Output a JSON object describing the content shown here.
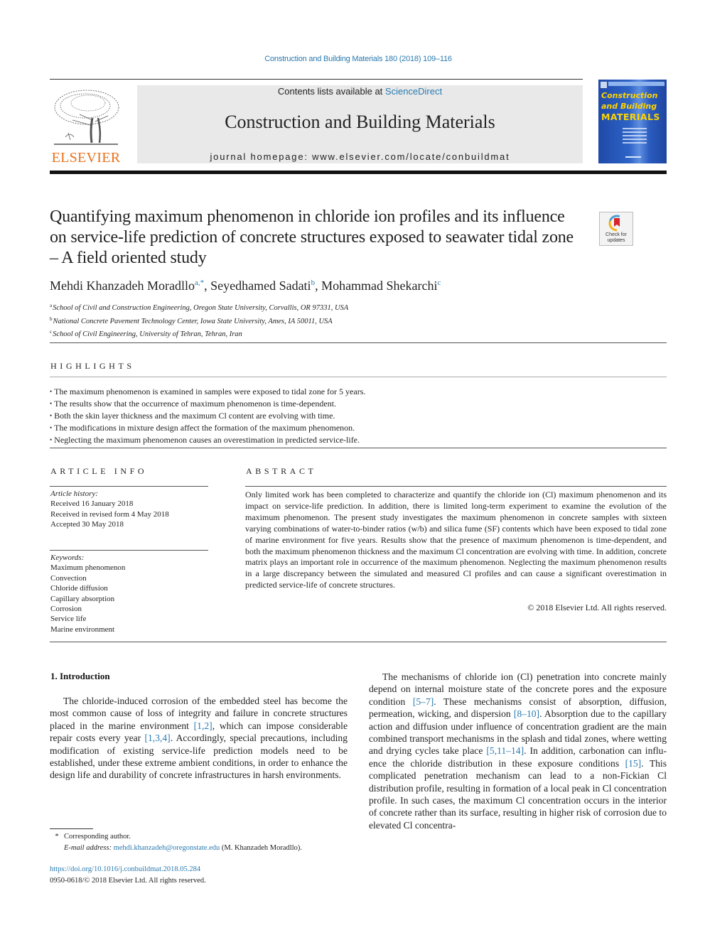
{
  "header": {
    "citation": "Construction and Building Materials 180 (2018) 109–116",
    "contents_prefix": "Contents lists available at ",
    "contents_link": "ScienceDirect",
    "journal_name": "Construction and Building Materials",
    "homepage": "journal homepage: www.elsevier.com/locate/conbuildmat",
    "publisher_logo": "ELSEVIER",
    "cover": {
      "line1": "Construction",
      "line2": "and Building",
      "line3": "MATERIALS"
    },
    "colors": {
      "link": "#2a7ab0",
      "elsevier_orange": "#e9711c",
      "cover_blue": "#2d63c7",
      "cover_yellow": "#ffd400"
    }
  },
  "article": {
    "title": "Quantifying maximum phenomenon in chloride ion profiles and its influence on service-life prediction of concrete structures exposed to seawater tidal zone – A field oriented study",
    "check_updates_label_1": "Check for",
    "check_updates_label_2": "updates",
    "authors": [
      {
        "name": "Mehdi Khanzadeh Moradllo",
        "sup": "a,*"
      },
      {
        "name": "Seyedhamed Sadati",
        "sup": "b"
      },
      {
        "name": "Mohammad Shekarchi",
        "sup": "c"
      }
    ],
    "author_separator": ", ",
    "affiliations": [
      {
        "sup": "a",
        "text": "School of Civil and Construction Engineering, Oregon State University, Corvallis, OR 97331, USA"
      },
      {
        "sup": "b",
        "text": "National Concrete Pavement Technology Center, Iowa State University, Ames, IA 50011, USA"
      },
      {
        "sup": "c",
        "text": "School of Civil Engineering, University of Tehran, Tehran, Iran"
      }
    ]
  },
  "highlights": {
    "heading": "HIGHLIGHTS",
    "items": [
      "The maximum phenomenon is examined in samples were exposed to tidal zone for 5 years.",
      "The results show that the occurrence of maximum phenomenon is time-dependent.",
      "Both the skin layer thickness and the maximum Cl content are evolving with time.",
      "The modifications in mixture design affect the formation of the maximum phenomenon.",
      "Neglecting the maximum phenomenon causes an overestimation in predicted service-life."
    ]
  },
  "article_info": {
    "heading": "ARTICLE INFO",
    "history_label": "Article history:",
    "history": [
      "Received 16 January 2018",
      "Received in revised form 4 May 2018",
      "Accepted 30 May 2018"
    ],
    "keywords_label": "Keywords:",
    "keywords": [
      "Maximum phenomenon",
      "Convection",
      "Chloride diffusion",
      "Capillary absorption",
      "Corrosion",
      "Service life",
      "Marine environment"
    ]
  },
  "abstract": {
    "heading": "ABSTRACT",
    "text": "Only limited work has been completed to characterize and quantify the chloride ion (Cl) maximum phe­nomenon and its impact on service-life prediction. In addition, there is limited long-term experiment to examine the evolution of the maximum phenomenon. The present study investigates the maximum phe­nomenon in concrete samples with sixteen varying combinations of water-to-binder ratios (w/b) and sil­ica fume (SF) contents which have been exposed to tidal zone of marine environment for five years. Results show that the presence of maximum phenomenon is time-dependent, and both the maximum phenomenon thickness and the maximum Cl concentration are evolving with time. In addition, concrete matrix plays an important role in occurrence of the maximum phenomenon. Neglecting the maximum phenomenon results in a large discrepancy between the simulated and measured Cl profiles and can cause a significant overestimation in predicted service-life of concrete structures.",
    "copyright": "© 2018 Elsevier Ltd. All rights reserved."
  },
  "body": {
    "section_heading": "1. Introduction",
    "left_paragraph": {
      "t1": "The chloride-induced corrosion of the embedded steel has become the most common cause of loss of integrity and failure in concrete structures placed in the marine environment ",
      "r1": "[1,2]",
      "t2": ", which can impose considerable repair costs every year ",
      "r2": "[1,3,4]",
      "t3": ". Accordingly, special precautions, including modification of existing service-life prediction models need to be established, under these extreme ambient conditions, in order to enhance the design life and durability of concrete infrastructures in harsh environments."
    },
    "right_paragraph": {
      "t1": "The mechanisms of chloride ion (Cl) penetration into concrete mainly depend on internal moisture state of the concrete pores and the exposure condition ",
      "r1": "[5–7]",
      "t2": ". These mechanisms consist of absorption, diffusion, permeation, wicking, and dispersion ",
      "r2": "[8–10]",
      "t3": ". Absorption due to the capillary action and diffusion under influ­ence of concentration gradient are the main combined transport mechanisms in the splash and tidal zones, where wetting and dry­ing cycles take place ",
      "r3": "[5,11–14]",
      "t4": ". In addition, carbonation can influ­ence the chloride distribution in these exposure conditions ",
      "r4": "[15]",
      "t5": ". This complicated penetration mechanism can lead to a non-Fickian Cl distribution profile, resulting in formation of a local peak in Cl concentration profile. In such cases, the maximum Cl concen­tration occurs in the interior of concrete rather than its surface, resulting in higher risk of corrosion due to elevated Cl concentra-"
    }
  },
  "footer": {
    "star": "*",
    "corresponding": "Corresponding author.",
    "email_label": "E-mail address: ",
    "email": "mehdi.khanzadeh@oregonstate.edu",
    "email_suffix": " (M. Khanzadeh Moradllo).",
    "doi": "https://doi.org/10.1016/j.conbuildmat.2018.05.284",
    "issn": "0950-0618/© 2018 Elsevier Ltd. All rights reserved."
  }
}
